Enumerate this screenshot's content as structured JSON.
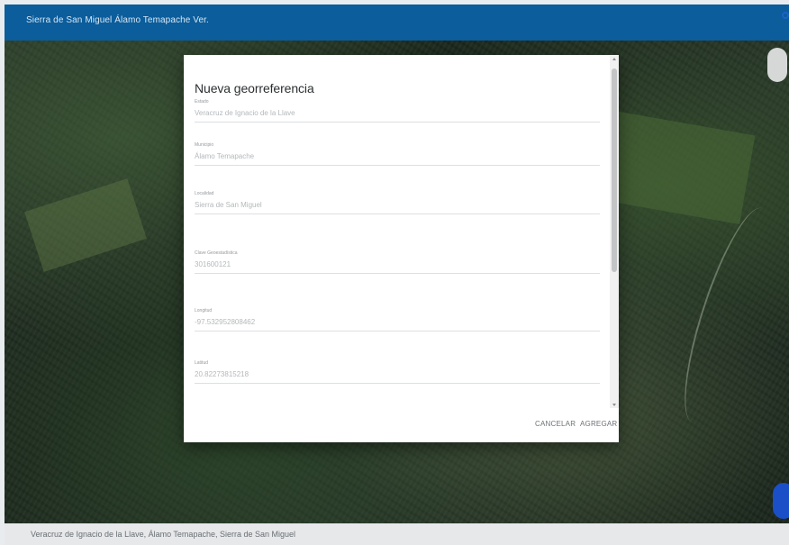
{
  "header": {
    "title": "Sierra de San Miguel Álamo Temapache Ver."
  },
  "dialog": {
    "title": "Nueva georreferencia",
    "fields": [
      {
        "label": "Estado",
        "value": "Veracruz de Ignacio de la Llave"
      },
      {
        "label": "Municipio",
        "value": "Álamo Temapache"
      },
      {
        "label": "Localidad",
        "value": "Sierra de San Miguel"
      },
      {
        "label": "Clave Geoestadística",
        "value": "301600121"
      },
      {
        "label": "Longitud",
        "value": "-97.532952808462"
      },
      {
        "label": "Latitud",
        "value": "20.82273815218"
      }
    ],
    "actions": {
      "cancel_label": "CANCELAR",
      "add_label": "AGREGAR"
    }
  },
  "footer": {
    "location_text": "Veracruz de Ignacio de la Llave, Álamo Temapache, Sierra de San Miguel"
  },
  "icons": {
    "map_control": "map-control-circle-icon",
    "fab": "fab-circle-icon",
    "status": "location-status-icon"
  },
  "colors": {
    "topbar": "#0b5d9b",
    "dialog_bg": "#ffffff",
    "footer_bg": "#e6e8ea",
    "fab": "#1b4fc7"
  }
}
